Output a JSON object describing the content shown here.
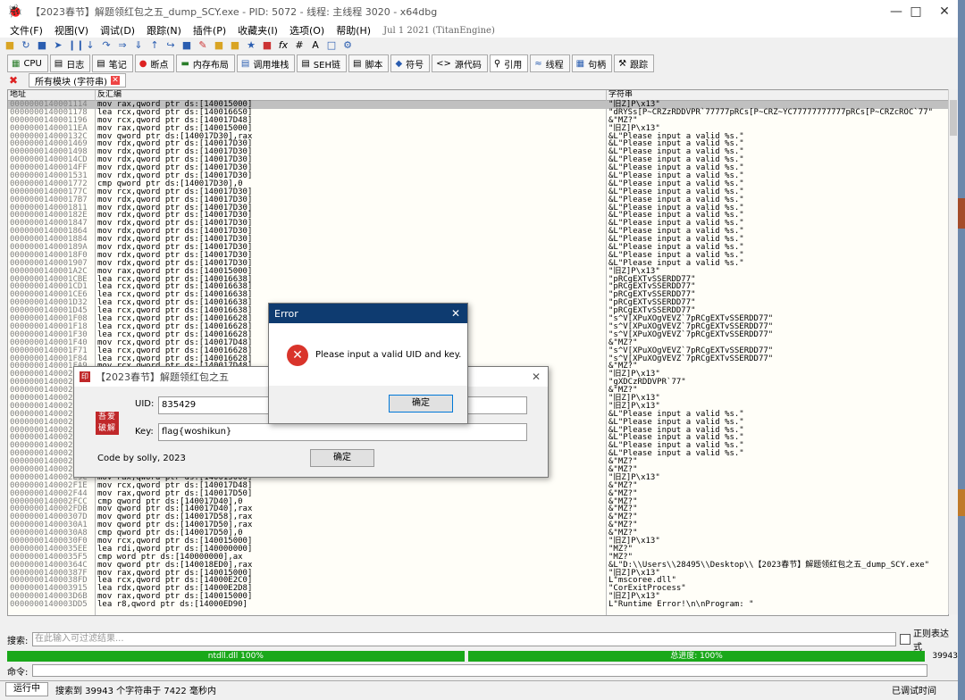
{
  "window": {
    "title": "【2023春节】解题领红包之五_dump_SCY.exe - PID: 5072 - 线程: 主线程 3020 - x64dbg",
    "app_icon": "bug-icon"
  },
  "menu": {
    "items": [
      "文件(F)",
      "视图(V)",
      "调试(D)",
      "跟踪(N)",
      "插件(P)",
      "收藏夹(I)",
      "选项(O)",
      "帮助(H)"
    ],
    "build_date": "Jul 1 2021 (TitanEngine)"
  },
  "tabs": [
    {
      "label": "CPU",
      "icon": "cpu-icon"
    },
    {
      "label": "日志",
      "icon": "log-icon"
    },
    {
      "label": "笔记",
      "icon": "notes-icon"
    },
    {
      "label": "断点",
      "icon": "breakpoint-icon"
    },
    {
      "label": "内存布局",
      "icon": "memory-icon"
    },
    {
      "label": "调用堆栈",
      "icon": "callstack-icon"
    },
    {
      "label": "SEH链",
      "icon": "seh-icon"
    },
    {
      "label": "脚本",
      "icon": "script-icon"
    },
    {
      "label": "符号",
      "icon": "symbol-icon"
    },
    {
      "label": "源代码",
      "icon": "source-icon"
    },
    {
      "label": "引用",
      "icon": "reference-icon"
    },
    {
      "label": "线程",
      "icon": "thread-icon"
    },
    {
      "label": "句柄",
      "icon": "handle-icon"
    },
    {
      "label": "跟踪",
      "icon": "trace-icon"
    }
  ],
  "subtab": {
    "label": "所有模块 (字符串)"
  },
  "grid": {
    "headers": {
      "address": "地址",
      "disasm": "反汇编",
      "string": "字符串"
    },
    "rows": [
      {
        "addr": "0000000140001114",
        "disasm": "mov rax,qword ptr ds:[140015000]",
        "str": "\"旧Z]P\\x13\""
      },
      {
        "addr": "0000000140001178",
        "disasm": "lea rcx,qword ptr ds:[1400166S0]",
        "str": "\"dRYSs[P~CRZzRDDVPR`77777pRCs[P~CRZ~YC77777777777pRCs[P~CRZcROC`77\""
      },
      {
        "addr": "0000000140001196",
        "disasm": "mov rcx,qword ptr ds:[140017D48]",
        "str": "&\"MZ?\""
      },
      {
        "addr": "00000001400011EA",
        "disasm": "mov rax,qword ptr ds:[140015000]",
        "str": "\"旧Z]P\\x13\""
      },
      {
        "addr": "000000014000132C",
        "disasm": "mov qword ptr ds:[140017D30],rax",
        "str": "&L\"Please input a valid %s.\""
      },
      {
        "addr": "0000000140001469",
        "disasm": "mov rdx,qword ptr ds:[140017D30]",
        "str": "&L\"Please input a valid %s.\""
      },
      {
        "addr": "0000000140001498",
        "disasm": "mov rdx,qword ptr ds:[140017D30]",
        "str": "&L\"Please input a valid %s.\""
      },
      {
        "addr": "00000001400014CD",
        "disasm": "mov rdx,qword ptr ds:[140017D30]",
        "str": "&L\"Please input a valid %s.\""
      },
      {
        "addr": "00000001400014FF",
        "disasm": "mov rdx,qword ptr ds:[140017D30]",
        "str": "&L\"Please input a valid %s.\""
      },
      {
        "addr": "0000000140001531",
        "disasm": "mov rdx,qword ptr ds:[140017D30]",
        "str": "&L\"Please input a valid %s.\""
      },
      {
        "addr": "0000000140001772",
        "disasm": "cmp qword ptr ds:[140017D30],0",
        "str": "&L\"Please input a valid %s.\""
      },
      {
        "addr": "000000014000177C",
        "disasm": "mov rcx,qword ptr ds:[140017D30]",
        "str": "&L\"Please input a valid %s.\""
      },
      {
        "addr": "00000001400017B7",
        "disasm": "mov rdx,qword ptr ds:[140017D30]",
        "str": "&L\"Please input a valid %s.\""
      },
      {
        "addr": "0000000140001811",
        "disasm": "mov rdx,qword ptr ds:[140017D30]",
        "str": "&L\"Please input a valid %s.\""
      },
      {
        "addr": "000000014000182E",
        "disasm": "mov rdx,qword ptr ds:[140017D30]",
        "str": "&L\"Please input a valid %s.\""
      },
      {
        "addr": "0000000140001847",
        "disasm": "mov rdx,qword ptr ds:[140017D30]",
        "str": "&L\"Please input a valid %s.\""
      },
      {
        "addr": "0000000140001864",
        "disasm": "mov rdx,qword ptr ds:[140017D30]",
        "str": "&L\"Please input a valid %s.\""
      },
      {
        "addr": "0000000140001884",
        "disasm": "mov rdx,qword ptr ds:[140017D30]",
        "str": "&L\"Please input a valid %s.\""
      },
      {
        "addr": "000000014000189A",
        "disasm": "mov rdx,qword ptr ds:[140017D30]",
        "str": "&L\"Please input a valid %s.\""
      },
      {
        "addr": "00000001400018F0",
        "disasm": "mov rdx,qword ptr ds:[140017D30]",
        "str": "&L\"Please input a valid %s.\""
      },
      {
        "addr": "0000000140001907",
        "disasm": "mov rdx,qword ptr ds:[140017D30]",
        "str": "&L\"Please input a valid %s.\""
      },
      {
        "addr": "0000000140001A2C",
        "disasm": "mov rax,qword ptr ds:[140015000]",
        "str": "\"旧Z]P\\x13\""
      },
      {
        "addr": "0000000140001CBE",
        "disasm": "lea rcx,qword ptr ds:[140016638]",
        "str": "\"pRCgEXTvSSERDD77\""
      },
      {
        "addr": "0000000140001CD1",
        "disasm": "lea rcx,qword ptr ds:[140016638]",
        "str": "\"pRCgEXTvSSERDD77\""
      },
      {
        "addr": "0000000140001CE6",
        "disasm": "lea rcx,qword ptr ds:[140016638]",
        "str": "\"pRCgEXTvSSERDD77\""
      },
      {
        "addr": "0000000140001D32",
        "disasm": "lea rcx,qword ptr ds:[140016638]",
        "str": "\"pRCgEXTvSSERDD77\""
      },
      {
        "addr": "0000000140001D45",
        "disasm": "lea rcx,qword ptr ds:[140016638]",
        "str": "\"pRCgEXTvSSERDD77\""
      },
      {
        "addr": "0000000140001F08",
        "disasm": "lea rcx,qword ptr ds:[140016628]",
        "str": "\"s^V[XPuXOgVEVZ`7pRCgEXTvSSERDD77\""
      },
      {
        "addr": "0000000140001F18",
        "disasm": "lea rcx,qword ptr ds:[140016628]",
        "str": "\"s^V[XPuXOgVEVZ`7pRCgEXTvSSERDD77\""
      },
      {
        "addr": "0000000140001F30",
        "disasm": "lea rcx,qword ptr ds:[140016628]",
        "str": "\"s^V[XPuXOgVEVZ`7pRCgEXTvSSERDD77\""
      },
      {
        "addr": "0000000140001F40",
        "disasm": "mov rcx,qword ptr ds:[140017D48]",
        "str": "&\"MZ?\""
      },
      {
        "addr": "0000000140001F71",
        "disasm": "lea rcx,qword ptr ds:[140016628]",
        "str": "\"s^V[XPuXOgVEVZ`7pRCgEXTvSSERDD77\""
      },
      {
        "addr": "0000000140001F84",
        "disasm": "lea rcx,qword ptr ds:[140016628]",
        "str": "\"s^V[XPuXOgVEVZ`7pRCgEXTvSSERDD77\""
      },
      {
        "addr": "0000000140001FA9",
        "disasm": "mov rcx,qword ptr ds:[140017D48]",
        "str": "&\"MZ?\""
      },
      {
        "addr": "0000000140002",
        "disasm": "",
        "str": "\"旧Z]P\\x13\""
      },
      {
        "addr": "0000000140002",
        "disasm": "",
        "str": "\"gXDCzRDDVPR`77\""
      },
      {
        "addr": "0000000140002",
        "disasm": "",
        "str": "&\"MZ?\""
      },
      {
        "addr": "0000000140002",
        "disasm": "",
        "str": "\"旧Z]P\\x13\""
      },
      {
        "addr": "0000000140002",
        "disasm": "",
        "str": "\"旧Z]P\\x13\""
      },
      {
        "addr": "0000000140002",
        "disasm": "",
        "str": "&L\"Please input a valid %s.\""
      },
      {
        "addr": "0000000140002",
        "disasm": "",
        "str": "&L\"Please input a valid %s.\""
      },
      {
        "addr": "0000000140002",
        "disasm": "",
        "str": "&L\"Please input a valid %s.\""
      },
      {
        "addr": "0000000140002",
        "disasm": "",
        "str": "&L\"Please input a valid %s.\""
      },
      {
        "addr": "0000000140002",
        "disasm": "",
        "str": "&L\"Please input a valid %s.\""
      },
      {
        "addr": "0000000140002",
        "disasm": "",
        "str": "&L\"Please input a valid %s.\""
      },
      {
        "addr": "0000000140002",
        "disasm": "",
        "str": "&\"MZ?\""
      },
      {
        "addr": "0000000140002E31",
        "disasm": "mov qword ptr ds:[140017D48],rax",
        "str": "&\"MZ?\""
      },
      {
        "addr": "0000000140002E9C",
        "disasm": "mov rax,qword ptr ds:[140015000]",
        "str": "\"旧Z]P\\x13\""
      },
      {
        "addr": "0000000140002F1E",
        "disasm": "mov rcx,qword ptr ds:[140017D48]",
        "str": "&\"MZ?\""
      },
      {
        "addr": "0000000140002F44",
        "disasm": "mov rax,qword ptr ds:[140017D50]",
        "str": "&\"MZ?\""
      },
      {
        "addr": "0000000140002FCC",
        "disasm": "cmp qword ptr ds:[140017D40],0",
        "str": "&\"MZ?\""
      },
      {
        "addr": "0000000140002FDB",
        "disasm": "mov qword ptr ds:[140017D40],rax",
        "str": "&\"MZ?\""
      },
      {
        "addr": "000000014000307D",
        "disasm": "mov qword ptr ds:[140017D58],rax",
        "str": "&\"MZ?\""
      },
      {
        "addr": "00000001400030A1",
        "disasm": "mov qword ptr ds:[140017D50],rax",
        "str": "&\"MZ?\""
      },
      {
        "addr": "00000001400030A8",
        "disasm": "cmp qword ptr ds:[140017D50],0",
        "str": "&\"MZ?\""
      },
      {
        "addr": "00000001400030F0",
        "disasm": "mov rcx,qword ptr ds:[140015000]",
        "str": "\"旧Z]P\\x13\""
      },
      {
        "addr": "00000001400035EE",
        "disasm": "lea rdi,qword ptr ds:[140000000]",
        "str": "\"MZ?\""
      },
      {
        "addr": "00000001400035F5",
        "disasm": "cmp word ptr ds:[140000000],ax",
        "str": "\"MZ?\""
      },
      {
        "addr": "000000014000364C",
        "disasm": "mov qword ptr ds:[140018ED0],rax",
        "str": "&L\"D:\\\\Users\\\\28495\\\\Desktop\\\\【2023春节】解题领红包之五_dump_SCY.exe\""
      },
      {
        "addr": "000000014000387F",
        "disasm": "mov rax,qword ptr ds:[140015000]",
        "str": "\"旧Z]P\\x13\""
      },
      {
        "addr": "00000001400038FD",
        "disasm": "lea rcx,qword ptr ds:[14000E2C0]",
        "str": "L\"mscoree.dll\""
      },
      {
        "addr": "0000000140003915",
        "disasm": "lea rdx,qword ptr ds:[14000E2D8]",
        "str": "\"CorExitProcess\""
      },
      {
        "addr": "0000000140003D6B",
        "disasm": "mov rax,qword ptr ds:[140015000]",
        "str": "\"旧Z]P\\x13\""
      },
      {
        "addr": "0000000140003DD5",
        "disasm": "lea r8,qword ptr ds:[14000ED90]",
        "str": "L\"Runtime Error!\\n\\nProgram: \""
      }
    ]
  },
  "search": {
    "label": "搜索:",
    "placeholder": "在此输入可过滤结果...",
    "regex_label": "正则表达式"
  },
  "progress": {
    "left_label": "ntdll.dll 100%",
    "left_value": 100,
    "right_label": "总进度: 100%",
    "right_value": 100,
    "count": "39943"
  },
  "command": {
    "label": "命令:"
  },
  "statusbar": {
    "state": "运行中",
    "message": "搜索到 39943 个字符串于 7422 毫秒内",
    "right": "已调试时间"
  },
  "error_dialog": {
    "title": "Error",
    "message": "Please input a valid UID and key.",
    "ok_label": "确定",
    "icon": "error-icon"
  },
  "app_dialog": {
    "title": "【2023春节】解题领红包之五",
    "uid_label": "UID:",
    "uid_value": "835429",
    "key_label": "Key:",
    "key_value": "flag{woshikun}",
    "footer": "Code by solly, 2023",
    "ok_label": "确定",
    "stamp": "吾爱破解",
    "icon": "seal-icon"
  },
  "colors": {
    "accent": "#1aa81a",
    "selection": "#c0c0c0",
    "address": "#808080",
    "error_red": "#d9342b"
  }
}
